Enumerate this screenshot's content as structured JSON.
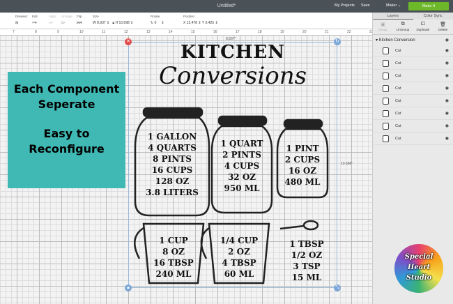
{
  "topbar": {
    "title": "Untitled*",
    "my_projects": "My Projects",
    "save": "Save",
    "machine": "Maker",
    "make_it": "Make It"
  },
  "toolbar": {
    "deselect": "Deselect",
    "edit": "Edit",
    "align": "Align",
    "arrange": "Arrange",
    "flip": "Flip",
    "size": "Size",
    "w_label": "W",
    "w": "8.937",
    "h_label": "H",
    "h": "10.698",
    "rotate": "Rotate",
    "rotate_value": "0",
    "position": "Position",
    "x_label": "X",
    "x": "12.478",
    "y_label": "Y",
    "y": "0.425"
  },
  "ruler": [
    "7",
    "8",
    "9",
    "10",
    "11",
    "12",
    "13",
    "14",
    "15",
    "16",
    "17",
    "18",
    "19",
    "20",
    "21",
    "22",
    "23"
  ],
  "panel": {
    "tabs": [
      "Layers",
      "Color Sync"
    ],
    "actions": [
      "Group",
      "UnGroup",
      "Duplicate",
      "Delete"
    ],
    "group_name": "Kitchen Conversion",
    "layers": [
      "Cut",
      "Cut",
      "Cut",
      "Cut",
      "Cut",
      "Cut",
      "Cut",
      "Cut"
    ]
  },
  "canvas": {
    "width_label": "8.937\"",
    "height_label": "10.698\"",
    "title1": "KITCHEN",
    "title2": "Conversions",
    "jars": [
      [
        "1 GALLON",
        "4 QUARTS",
        "8 PINTS",
        "16 CUPS",
        "128 OZ",
        "3.8 LITERS"
      ],
      [
        "1 QUART",
        "2 PINTS",
        "4 CUPS",
        "32 OZ",
        "950 ML"
      ],
      [
        "1 PINT",
        "2 CUPS",
        "16 OZ",
        "480 ML"
      ]
    ],
    "cups": [
      [
        "1 CUP",
        "8 OZ",
        "16 TBSP",
        "240 ML"
      ],
      [
        "1/4 CUP",
        "2 OZ",
        "4 TBSP",
        "60 ML"
      ],
      [
        "1 TBSP",
        "1/2 OZ",
        "3 TSP",
        "15 ML"
      ]
    ]
  },
  "overlay": {
    "line1": "Each Component",
    "line2": "Seperate",
    "line3": "Easy to",
    "line4": "Reconfigure"
  },
  "logo": {
    "text": "Special Heart Studio"
  },
  "colors": {
    "make_it": "#6cb829",
    "overlay": "#40b9b4",
    "selection": "#9ab8d8"
  }
}
